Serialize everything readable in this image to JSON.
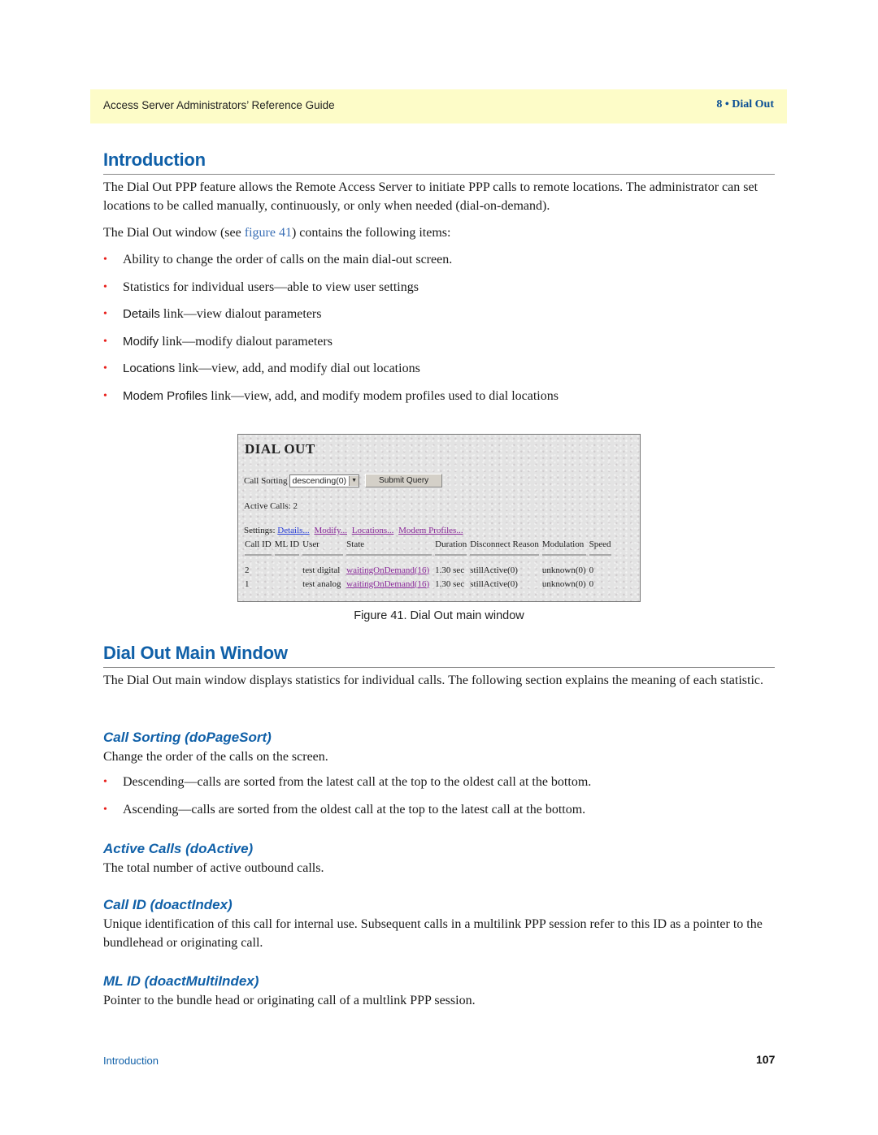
{
  "header": {
    "guide_title": "Access Server Administrators’ Reference Guide",
    "chapter": "8 • Dial Out"
  },
  "intro": {
    "heading": "Introduction",
    "para1": "The Dial Out PPP feature allows the Remote Access Server to initiate PPP calls to remote locations. The administrator can set locations to be called manually, continuously, or only when needed (dial-on-demand).",
    "para2_before": "The Dial Out window (see ",
    "para2_link": "figure 41",
    "para2_after": ") contains the following items:",
    "bullets": [
      {
        "kw": "",
        "text": "Ability to change the order of calls on the main dial-out screen."
      },
      {
        "kw": "",
        "text": "Statistics for individual users—able to view user settings"
      },
      {
        "kw": "Details",
        "text": " link—view dialout parameters"
      },
      {
        "kw": "Modify",
        "text": " link—modify dialout parameters"
      },
      {
        "kw": "Locations",
        "text": " link—view, add, and modify dial out locations"
      },
      {
        "kw": "Modem Profiles",
        "text": " link—view, add, and modify modem profiles used to dial locations"
      }
    ]
  },
  "figure": {
    "title": "DIAL OUT",
    "call_sorting_label": "Call Sorting",
    "call_sorting_value": "descending(0)",
    "submit_label": "Submit Query",
    "active_calls_label": "Active Calls: 2",
    "settings_label": "Settings:",
    "settings_links": [
      "Details...",
      "Modify...",
      "Locations...",
      "Modem Profiles..."
    ],
    "columns": [
      "Call ID",
      "ML ID",
      "User",
      "State",
      "Duration",
      "Disconnect Reason",
      "Modulation",
      "Speed"
    ],
    "rows": [
      {
        "call_id": "2",
        "ml_id": "",
        "user": "test digital",
        "state": "waitingOnDemand(16)",
        "duration": "1.30 sec",
        "reason": "stillActive(0)",
        "modulation": "unknown(0)",
        "speed": "0"
      },
      {
        "call_id": "1",
        "ml_id": "",
        "user": "test analog",
        "state": "waitingOnDemand(16)",
        "duration": "1.30 sec",
        "reason": "stillActive(0)",
        "modulation": "unknown(0)",
        "speed": "0"
      }
    ],
    "caption": "Figure 41. Dial Out main window"
  },
  "main_window": {
    "heading": "Dial Out Main Window",
    "para": "The Dial Out main window displays statistics for individual calls. The following section explains the meaning of each statistic."
  },
  "call_sorting": {
    "heading": "Call Sorting (doPageSort)",
    "para": "Change the order of the calls on the screen.",
    "bullets": [
      "Descending—calls are sorted from the latest call at the top to the oldest call at the bottom.",
      "Ascending—calls are sorted from the oldest call at the top to the latest call at the bottom."
    ]
  },
  "active_calls": {
    "heading": "Active Calls (doActive)",
    "para": "The total number of active outbound calls."
  },
  "call_id": {
    "heading": "Call ID (doactIndex)",
    "para": "Unique identification of this call for internal use. Subsequent calls in a multilink PPP session refer to this ID as a pointer to the bundlehead or originating call."
  },
  "ml_id": {
    "heading": "ML ID (doactMultiIndex)",
    "para": "Pointer to the bundle head or originating call of a multlink PPP session."
  },
  "footer": {
    "section": "Introduction",
    "page_number": "107"
  }
}
